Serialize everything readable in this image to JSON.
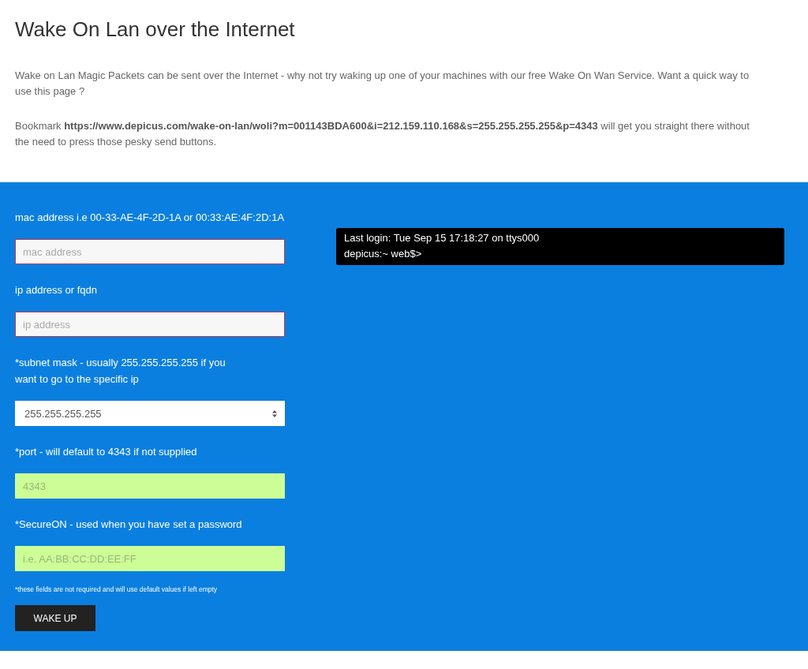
{
  "title": "Wake On Lan over the Internet",
  "paragraphs": [
    "Wake on Lan Magic Packets can be sent over the Internet - why not try waking up one of your machines with our free Wake On Wan Service. Want a quick way to use this page ?",
    "Bookmark **https://www.depicus.com/wake-on-lan/woli?m=001143BDA600&i=212.159.110.168&s=255.255.255.255&p=4343** will get you straight there without the need to press those pesky send buttons."
  ],
  "form": {
    "fields": [
      {
        "label": "mac address i.e 00-33-AE-4F-2D-1A or 00:33:AE:4F:2D:1A",
        "kind": "required",
        "placeholder": "mac address"
      },
      {
        "label": "ip address or fqdn",
        "kind": "required",
        "placeholder": "ip address"
      },
      {
        "label": "*subnet mask - usually 255.255.255.255 if you want to go to the specific ip",
        "kind": "select",
        "value": "255.255.255.255"
      },
      {
        "label": "*port - will default to 4343 if not supplied",
        "kind": "optional",
        "placeholder": "4343"
      },
      {
        "label": "*SecureON - used when you have set a password",
        "kind": "optional",
        "placeholder": "i.e. AA:BB:CC:DD:EE:FF"
      }
    ],
    "note": "*these fields are not required and will use default values if left empty",
    "button": "WAKE UP"
  },
  "terminal": {
    "lines": [
      "Last login: Tue Sep 15 17:18:27 on ttys000",
      "depicus:~ web$>"
    ]
  }
}
